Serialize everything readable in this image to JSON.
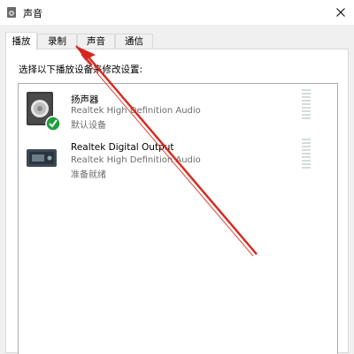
{
  "window": {
    "title": "声音",
    "title_icon": "speaker-icon",
    "close_icon": "close-icon"
  },
  "tabs": [
    {
      "label": "播放",
      "active": true
    },
    {
      "label": "录制",
      "active": false
    },
    {
      "label": "声音",
      "active": false
    },
    {
      "label": "通信",
      "active": false
    }
  ],
  "panel": {
    "instruction": "选择以下播放设备来修改设置:",
    "devices": [
      {
        "name": "扬声器",
        "description": "Realtek High Definition Audio",
        "status": "默认设备",
        "icon": "speaker-device-icon",
        "badge": "default-check-icon"
      },
      {
        "name": "Realtek Digital Output",
        "description": "Realtek High Definition Audio",
        "status": "准备就绪",
        "icon": "digital-output-icon"
      }
    ]
  },
  "annotation": {
    "arrow_color": "#d9261c",
    "arrow_target": "录制"
  },
  "colors": {
    "check_badge": "#1e9e3a",
    "meter_bar": "#d4dcd9"
  }
}
